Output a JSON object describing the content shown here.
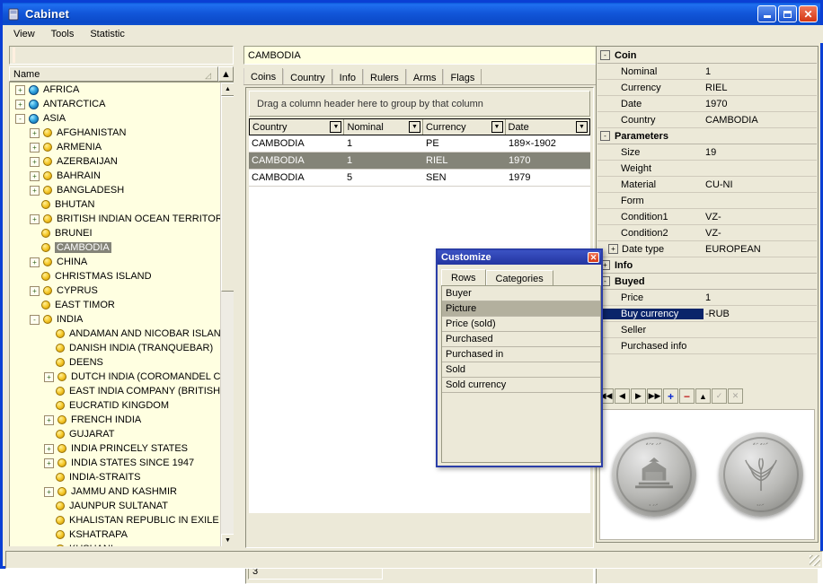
{
  "window": {
    "title": "Cabinet",
    "icon": "cabinet-icon",
    "buttons": {
      "minimize": "_",
      "maximize": "□",
      "close": "✕"
    },
    "title_color": "#1257da"
  },
  "menu": {
    "items": [
      "View",
      "Tools",
      "Statistic"
    ]
  },
  "sidebar": {
    "search_value": "",
    "column_header": "Name",
    "nodes": [
      {
        "label": "AFRICA",
        "indent": 0,
        "expander": "+",
        "icon": "globe-icon",
        "selected": false
      },
      {
        "label": "ANTARCTICA",
        "indent": 0,
        "expander": "+",
        "icon": "globe-icon",
        "selected": false
      },
      {
        "label": "ASIA",
        "indent": 0,
        "expander": "-",
        "icon": "globe-icon",
        "selected": false
      },
      {
        "label": "AFGHANISTAN",
        "indent": 1,
        "expander": "+",
        "icon": "coin-icon",
        "selected": false
      },
      {
        "label": "ARMENIA",
        "indent": 1,
        "expander": "+",
        "icon": "coin-icon",
        "selected": false
      },
      {
        "label": "AZERBAIJAN",
        "indent": 1,
        "expander": "+",
        "icon": "coin-icon",
        "selected": false
      },
      {
        "label": "BAHRAIN",
        "indent": 1,
        "expander": "+",
        "icon": "coin-icon",
        "selected": false
      },
      {
        "label": "BANGLADESH",
        "indent": 1,
        "expander": "+",
        "icon": "coin-icon",
        "selected": false
      },
      {
        "label": "BHUTAN",
        "indent": 1,
        "expander": "",
        "icon": "coin-icon",
        "selected": false
      },
      {
        "label": "BRITISH INDIAN OCEAN TERRITORY",
        "indent": 1,
        "expander": "+",
        "icon": "coin-icon",
        "selected": false
      },
      {
        "label": "BRUNEI",
        "indent": 1,
        "expander": "",
        "icon": "coin-icon",
        "selected": false
      },
      {
        "label": "CAMBODIA",
        "indent": 1,
        "expander": "",
        "icon": "coin-icon",
        "selected": true
      },
      {
        "label": "CHINA",
        "indent": 1,
        "expander": "+",
        "icon": "coin-icon",
        "selected": false
      },
      {
        "label": "CHRISTMAS ISLAND",
        "indent": 1,
        "expander": "",
        "icon": "coin-icon",
        "selected": false
      },
      {
        "label": "CYPRUS",
        "indent": 1,
        "expander": "+",
        "icon": "coin-icon",
        "selected": false
      },
      {
        "label": "EAST TIMOR",
        "indent": 1,
        "expander": "",
        "icon": "coin-icon",
        "selected": false
      },
      {
        "label": "INDIA",
        "indent": 1,
        "expander": "-",
        "icon": "coin-icon",
        "selected": false
      },
      {
        "label": "ANDAMAN AND NICOBAR ISLAND",
        "indent": 2,
        "expander": "",
        "icon": "coin-icon",
        "selected": false
      },
      {
        "label": "DANISH INDIA  (TRANQUEBAR)",
        "indent": 2,
        "expander": "",
        "icon": "coin-icon",
        "selected": false
      },
      {
        "label": "DEENS",
        "indent": 2,
        "expander": "",
        "icon": "coin-icon",
        "selected": false
      },
      {
        "label": "DUTCH INDIA (COROMANDEL CO",
        "indent": 2,
        "expander": "+",
        "icon": "coin-icon",
        "selected": false
      },
      {
        "label": "EAST INDIA COMPANY (BRITISH)",
        "indent": 2,
        "expander": "",
        "icon": "coin-icon",
        "selected": false
      },
      {
        "label": "EUCRATID KINGDOM",
        "indent": 2,
        "expander": "",
        "icon": "coin-icon",
        "selected": false
      },
      {
        "label": "FRENCH INDIA",
        "indent": 2,
        "expander": "+",
        "icon": "coin-icon",
        "selected": false
      },
      {
        "label": "GUJARAT",
        "indent": 2,
        "expander": "",
        "icon": "coin-icon",
        "selected": false
      },
      {
        "label": "INDIA PRINCELY STATES",
        "indent": 2,
        "expander": "+",
        "icon": "coin-icon",
        "selected": false
      },
      {
        "label": "INDIA STATES SINCE 1947",
        "indent": 2,
        "expander": "+",
        "icon": "coin-icon",
        "selected": false
      },
      {
        "label": "INDIA-STRAITS",
        "indent": 2,
        "expander": "",
        "icon": "coin-icon",
        "selected": false
      },
      {
        "label": "JAMMU AND KASHMIR",
        "indent": 2,
        "expander": "+",
        "icon": "coin-icon",
        "selected": false
      },
      {
        "label": "JAUNPUR SULTANAT",
        "indent": 2,
        "expander": "",
        "icon": "coin-icon",
        "selected": false
      },
      {
        "label": "KHALISTAN REPUBLIC IN EXILE",
        "indent": 2,
        "expander": "",
        "icon": "coin-icon",
        "selected": false
      },
      {
        "label": "KSHATRAPA",
        "indent": 2,
        "expander": "",
        "icon": "coin-icon",
        "selected": false
      },
      {
        "label": "KUSHANI",
        "indent": 2,
        "expander": "",
        "icon": "coin-icon",
        "selected": false
      }
    ]
  },
  "main": {
    "country_value": "CAMBODIA",
    "dropdown_icon": "coin-icon",
    "tabs": [
      {
        "label": "Coins",
        "active": true
      },
      {
        "label": "Country",
        "active": false
      },
      {
        "label": "Info",
        "active": false
      },
      {
        "label": "Rulers",
        "active": false
      },
      {
        "label": "Arms",
        "active": false
      },
      {
        "label": "Flags",
        "active": false
      }
    ],
    "group_hint": "Drag a column header here to group by that column",
    "grid": {
      "columns": [
        "Country",
        "Nominal",
        "Currency",
        "Date"
      ],
      "rows": [
        {
          "cells": [
            "CAMBODIA",
            "1",
            "PE",
            "189×-1902"
          ],
          "selected": false
        },
        {
          "cells": [
            "CAMBODIA",
            "1",
            "RIEL",
            "1970"
          ],
          "selected": true
        },
        {
          "cells": [
            "CAMBODIA",
            "5",
            "SEN",
            "1979"
          ],
          "selected": false
        }
      ]
    },
    "record_count": "3"
  },
  "inspector": {
    "sections": [
      {
        "title": "Coin",
        "expander": "-",
        "rows": [
          {
            "name": "Nominal",
            "value": "1",
            "selected": false,
            "expander": ""
          },
          {
            "name": "Currency",
            "value": "RIEL",
            "selected": false,
            "expander": ""
          },
          {
            "name": "Date",
            "value": "1970",
            "selected": false,
            "expander": ""
          },
          {
            "name": "Country",
            "value": "CAMBODIA",
            "selected": false,
            "expander": ""
          }
        ]
      },
      {
        "title": "Parameters",
        "expander": "-",
        "rows": [
          {
            "name": "Size",
            "value": "19",
            "selected": false,
            "expander": ""
          },
          {
            "name": "Weight",
            "value": "",
            "selected": false,
            "expander": ""
          },
          {
            "name": "Material",
            "value": "CU-NI",
            "selected": false,
            "expander": ""
          },
          {
            "name": "Form",
            "value": "",
            "selected": false,
            "expander": ""
          },
          {
            "name": "Condition1",
            "value": "VZ-",
            "selected": false,
            "expander": ""
          },
          {
            "name": "Condition2",
            "value": "VZ-",
            "selected": false,
            "expander": ""
          },
          {
            "name": "Date type",
            "value": "EUROPEAN",
            "selected": false,
            "expander": "+"
          }
        ]
      },
      {
        "title": "Info",
        "expander": "+",
        "rows": []
      },
      {
        "title": "Buyed",
        "expander": "-",
        "rows": [
          {
            "name": "Price",
            "value": "1",
            "selected": false,
            "expander": ""
          },
          {
            "name": "Buy currency",
            "value": "-RUB",
            "selected": true,
            "expander": ""
          },
          {
            "name": "Seller",
            "value": "",
            "selected": false,
            "expander": ""
          },
          {
            "name": "Purchased info",
            "value": "",
            "selected": false,
            "expander": ""
          }
        ]
      }
    ],
    "nav_buttons": [
      {
        "name": "first-record-button",
        "glyph": "◀◀",
        "style": "",
        "label": "first"
      },
      {
        "name": "prev-record-button",
        "glyph": "◀",
        "style": "",
        "label": "previous"
      },
      {
        "name": "next-record-button",
        "glyph": "▶",
        "style": "",
        "label": "next"
      },
      {
        "name": "last-record-button",
        "glyph": "▶▶",
        "style": "",
        "label": "last"
      },
      {
        "name": "add-record-button",
        "glyph": "+",
        "style": "blue",
        "label": "add"
      },
      {
        "name": "delete-record-button",
        "glyph": "−",
        "style": "red",
        "label": "delete"
      },
      {
        "name": "edit-record-button",
        "glyph": "▲",
        "style": "",
        "label": "edit"
      },
      {
        "name": "post-edit-button",
        "glyph": "✓",
        "style": "dis",
        "label": "post"
      },
      {
        "name": "cancel-edit-button",
        "glyph": "✕",
        "style": "dis",
        "label": "cancel"
      }
    ],
    "coin_images": [
      {
        "name": "coin-obverse-image",
        "legend_top": "ށޅ ޒޔޖ",
        "legend_bottom": "ރޅ ޑ"
      },
      {
        "name": "coin-reverse-image",
        "legend_top": "ށޅޒ ޔޖ",
        "legend_bottom": "ރޅޑ"
      }
    ]
  },
  "dialog": {
    "title": "Customize",
    "close_label": "✕",
    "tabs": [
      {
        "label": "Rows",
        "active": true
      },
      {
        "label": "Categories",
        "active": false
      }
    ],
    "items": [
      {
        "label": "Buyer",
        "selected": false
      },
      {
        "label": "Picture",
        "selected": true
      },
      {
        "label": "Price (sold)",
        "selected": false
      },
      {
        "label": "Purchased",
        "selected": false
      },
      {
        "label": "Purchased in",
        "selected": false
      },
      {
        "label": "Sold",
        "selected": false
      },
      {
        "label": "Sold currency",
        "selected": false
      }
    ]
  },
  "statusbar": {
    "text": ""
  }
}
